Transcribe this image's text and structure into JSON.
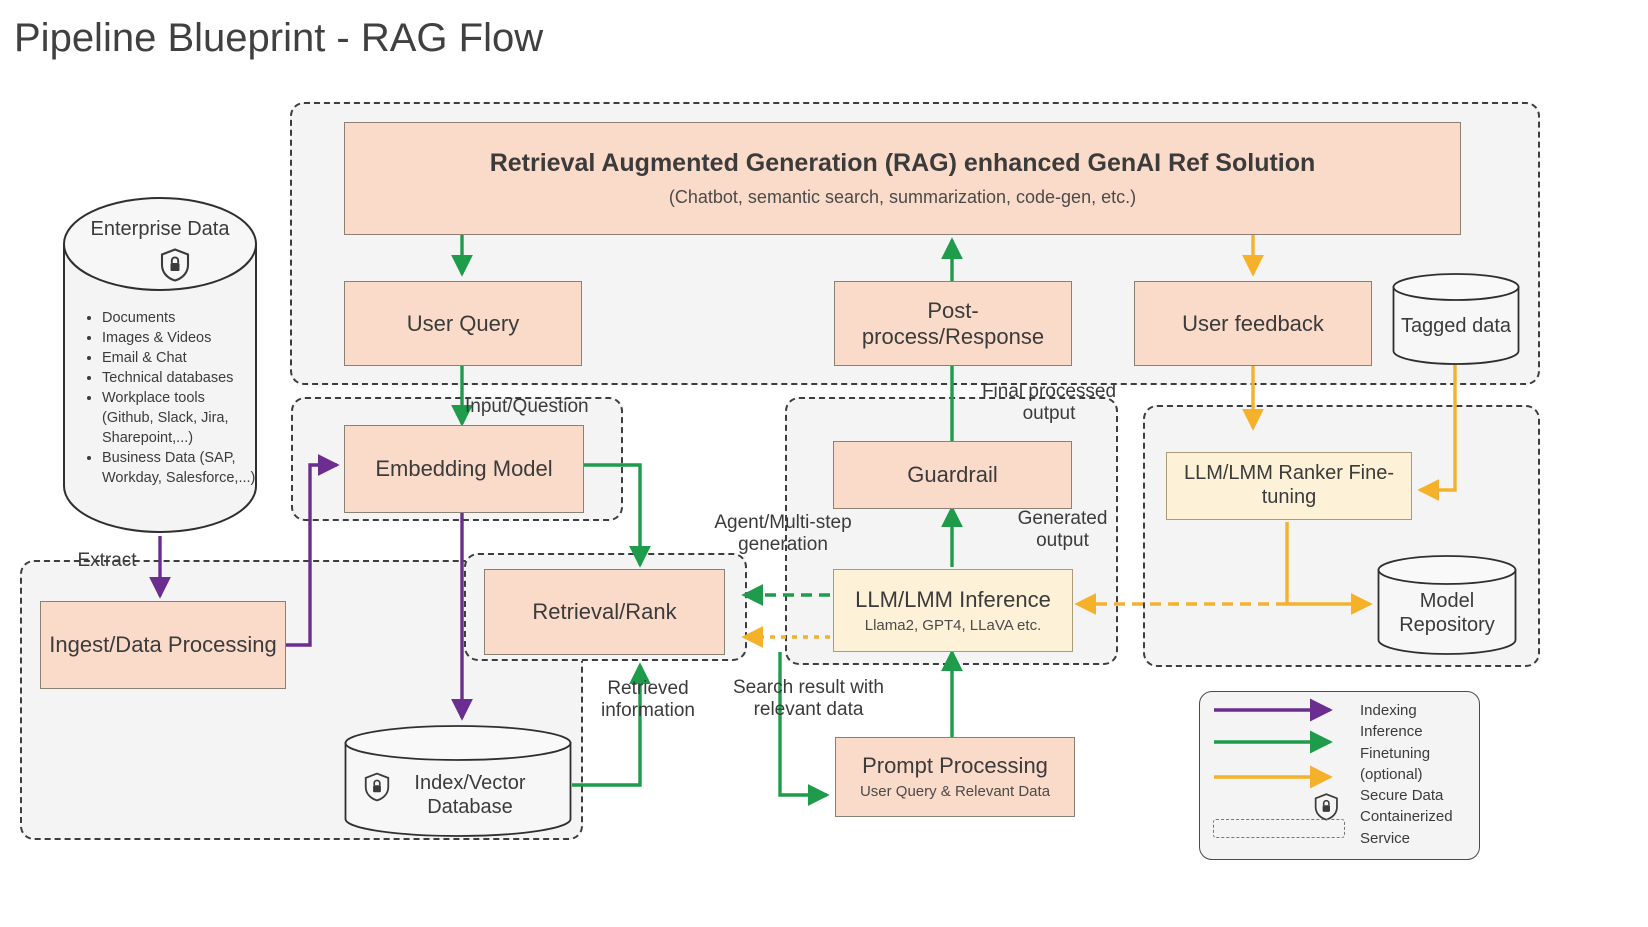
{
  "title": "Pipeline Blueprint - RAG Flow",
  "colors": {
    "peach": "#FADBC9",
    "cream": "#FDF1D8",
    "indexing": "#6B2D8F",
    "inference": "#1E9B4B",
    "finetuning": "#F6B12B",
    "zone_border": "#3D3D3D",
    "zone_fill": "#F4F4F4"
  },
  "enterprise_data": {
    "title": "Enterprise Data",
    "icon": "shield-lock-icon",
    "items": [
      "Documents",
      "Images & Videos",
      "Email & Chat",
      "Technical databases",
      "Workplace tools (Github, Slack, Jira, Sharepoint,...)",
      "Business Data (SAP, Workday, Salesforce,...)"
    ]
  },
  "nodes": {
    "rag_solution": {
      "title": "Retrieval Augmented Generation (RAG) enhanced GenAI Ref Solution",
      "subtitle": "(Chatbot, semantic search, summarization, code-gen, etc.)"
    },
    "user_query": {
      "title": "User Query"
    },
    "post_process": {
      "title": "Post-process/Response"
    },
    "user_feedback": {
      "title": "User feedback"
    },
    "tagged_data": {
      "title": "Tagged data"
    },
    "embedding_model": {
      "title": "Embedding Model"
    },
    "guardrail": {
      "title": "Guardrail"
    },
    "ranker_finetune": {
      "title": "LLM/LMM Ranker Fine-tuning"
    },
    "ingest": {
      "title": "Ingest/Data Processing"
    },
    "retrieval_rank": {
      "title": "Retrieval/Rank"
    },
    "llm_inference": {
      "title": "LLM/LMM Inference",
      "subtitle": "Llama2, GPT4, LLaVA etc."
    },
    "model_repository": {
      "title": "Model Repository"
    },
    "index_vector_db": {
      "title": "Index/Vector Database",
      "icon": "shield-lock-icon"
    },
    "prompt_processing": {
      "title": "Prompt Processing",
      "subtitle": "User Query & Relevant Data"
    }
  },
  "edge_labels": {
    "extract": "Extract",
    "input_question": "Input/Question",
    "agent_multistep": "Agent/Multi-step generation",
    "final_processed": "Final processed output",
    "generated_output": "Generated output",
    "retrieved_information": "Retrieved information",
    "search_result": "Search result with relevant data"
  },
  "legend": {
    "items": [
      {
        "label": "Indexing",
        "type": "arrow",
        "color": "#6B2D8F"
      },
      {
        "label": "Inference",
        "type": "arrow",
        "color": "#1E9B4B"
      },
      {
        "label": "Finetuning",
        "type": "arrow",
        "color": "#F6B12B"
      },
      {
        "label": "(optional)",
        "type": "text",
        "color": ""
      },
      {
        "label": "Secure Data",
        "type": "shield-lock-icon",
        "color": ""
      },
      {
        "label": "Containerized",
        "type": "dashed-box",
        "color": ""
      },
      {
        "label": "Service",
        "type": "text",
        "color": ""
      }
    ]
  }
}
